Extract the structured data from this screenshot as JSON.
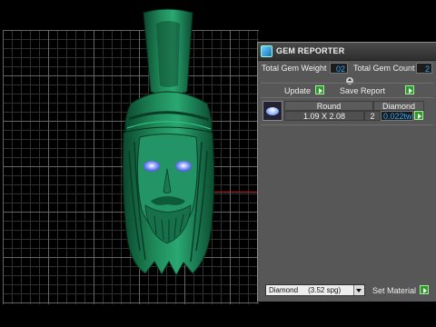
{
  "panel": {
    "title": "GEM REPORTER",
    "total_gem_weight_label": "Total Gem Weight",
    "total_gem_weight_value": "02",
    "total_gem_count_label": "Total Gem Count",
    "total_gem_count_value": "2",
    "update_label": "Update",
    "save_report_label": "Save Report",
    "gem_row": {
      "shape": "Round",
      "material": "Diamond",
      "size": "1.09 X 2.08",
      "count": "2",
      "weight": "0.022tw"
    },
    "material_select_value": "Diamond     (3.52 spg)",
    "set_material_label": "Set Material"
  },
  "colors": {
    "model_green": "#1f8a5a",
    "grid_major": "#6a6a6a",
    "grid_minor": "#333333",
    "axis_red": "#c31a1a",
    "value_blue": "#2aa8ff",
    "panel_bg": "#575757",
    "button_green": "#2e9a2a"
  },
  "icons": {
    "title_icon": "gem-reporter-app-icon",
    "collapse": "collapse-arrow-icon",
    "go": "green-play-arrow-icon",
    "gem_thumbnail": "round-diamond-thumbnail",
    "dropdown": "chevron-down-icon"
  }
}
